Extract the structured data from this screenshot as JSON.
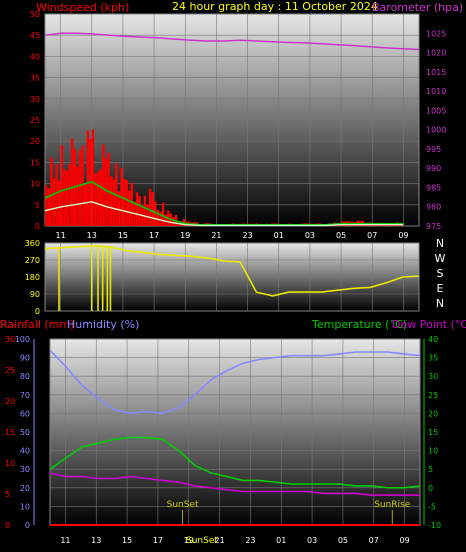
{
  "header": {
    "left_title": "Windspeed (kph)",
    "center_title": "24 hour graph day : 11 October 2024",
    "right_title": "Barometer (hpa)"
  },
  "colors": {
    "wind": "#ff0000",
    "gust": "#00cc00",
    "gust_light": "#ccffcc",
    "baro": "#cc33cc",
    "dir": "#e8e800",
    "humidity": "#8888ff",
    "temperature": "#00cc00",
    "dewpoint": "#cc00cc",
    "rain": "#ff0000",
    "temp_axis": "#00cc00",
    "sun_label": "#cccc00"
  },
  "x_ticks": [
    "11",
    "13",
    "15",
    "17",
    "19",
    "21",
    "23",
    "01",
    "03",
    "05",
    "07",
    "09"
  ],
  "chart_data": [
    {
      "type": "line",
      "panel": "wind-barometer",
      "x": [
        "10",
        "11",
        "12",
        "13",
        "14",
        "15",
        "16",
        "17",
        "18",
        "19",
        "20",
        "21",
        "22",
        "23",
        "00",
        "01",
        "02",
        "03",
        "04",
        "05",
        "06",
        "07",
        "08",
        "09"
      ],
      "series": [
        {
          "name": "Windspeed (kph)",
          "axis": "left",
          "values": [
            12,
            15,
            17,
            19,
            15,
            12,
            9,
            6,
            3,
            1,
            0.5,
            0.5,
            0.5,
            0.5,
            0.5,
            0.5,
            0.5,
            0.5,
            0.5,
            1,
            1,
            1,
            1,
            1
          ]
        },
        {
          "name": "Barometer (hpa)",
          "axis": "right",
          "values": [
            1024.5,
            1025,
            1025,
            1024.8,
            1024.5,
            1024.2,
            1024,
            1023.8,
            1023.5,
            1023.2,
            1023,
            1023,
            1023.2,
            1023,
            1022.8,
            1022.6,
            1022.5,
            1022.3,
            1022,
            1021.8,
            1021.5,
            1021.2,
            1021,
            1020.8
          ]
        }
      ],
      "left_axis": {
        "ticks": [
          "0",
          "5",
          "10",
          "15",
          "20",
          "25",
          "30",
          "35",
          "40",
          "45",
          "50"
        ],
        "range": [
          0,
          50
        ]
      },
      "right_axis": {
        "ticks": [
          "975",
          "980",
          "985",
          "990",
          "995",
          "1000",
          "1005",
          "1010",
          "1015",
          "1020",
          "1025"
        ],
        "range": [
          975,
          1030
        ]
      }
    },
    {
      "type": "line",
      "panel": "wind-direction",
      "x": [
        "10",
        "11",
        "12",
        "13",
        "14",
        "15",
        "16",
        "17",
        "18",
        "19",
        "20",
        "21",
        "22",
        "23",
        "00",
        "01",
        "02",
        "03",
        "04",
        "05",
        "06",
        "07",
        "08",
        "09"
      ],
      "series": [
        {
          "name": "Wind direction",
          "values": [
            330,
            335,
            340,
            345,
            340,
            320,
            310,
            300,
            295,
            290,
            280,
            265,
            260,
            100,
            80,
            100,
            100,
            100,
            110,
            120,
            125,
            150,
            180,
            185
          ]
        }
      ],
      "left_axis": {
        "ticks": [
          "0",
          "90",
          "180",
          "270",
          "360"
        ],
        "range": [
          0,
          360
        ]
      },
      "right_labels": [
        "N",
        "W",
        "S",
        "E",
        "N"
      ]
    },
    {
      "type": "line",
      "panel": "temperature-humidity",
      "x": [
        "10",
        "11",
        "12",
        "13",
        "14",
        "15",
        "16",
        "17",
        "18",
        "19",
        "20",
        "21",
        "22",
        "23",
        "00",
        "01",
        "02",
        "03",
        "04",
        "05",
        "06",
        "07",
        "08",
        "09"
      ],
      "series": [
        {
          "name": "Humidity (%)",
          "axis": "humidity",
          "values": [
            94,
            85,
            75,
            68,
            62,
            60,
            61,
            60,
            63,
            70,
            78,
            83,
            87,
            89,
            90,
            91,
            91,
            91,
            92,
            93,
            93,
            93,
            92,
            91
          ]
        },
        {
          "name": "Temperature (°C)",
          "axis": "right",
          "values": [
            5,
            8,
            11,
            12,
            13,
            13.5,
            13.5,
            13,
            10,
            6,
            4,
            3,
            2,
            2,
            1.5,
            1,
            1,
            1,
            1,
            0.5,
            0.5,
            0,
            0,
            0.5
          ]
        },
        {
          "name": "Dew Point (°C)",
          "axis": "right",
          "values": [
            4,
            3,
            3,
            2.5,
            2.5,
            3,
            2.5,
            2,
            1.5,
            0.5,
            0,
            -0.5,
            -1,
            -1,
            -1,
            -1,
            -1,
            -1.5,
            -1.5,
            -1.5,
            -2,
            -2,
            -2,
            -2
          ]
        },
        {
          "name": "Rainfall (mm)",
          "axis": "rain",
          "values": [
            0,
            0,
            0,
            0,
            0,
            0,
            0,
            0,
            0,
            0,
            0,
            0,
            0,
            0,
            0,
            0,
            0,
            0,
            0,
            0,
            0,
            0,
            0,
            0
          ]
        }
      ],
      "rain_axis": {
        "ticks": [
          "0",
          "5",
          "10",
          "15",
          "20",
          "25",
          "30"
        ],
        "range": [
          0,
          30
        ]
      },
      "humidity_axis": {
        "ticks": [
          "0",
          "10",
          "20",
          "30",
          "40",
          "50",
          "60",
          "70",
          "80",
          "90",
          "100"
        ],
        "range": [
          0,
          100
        ]
      },
      "right_axis": {
        "ticks": [
          "-10",
          "-5",
          "0",
          "5",
          "10",
          "15",
          "20",
          "25",
          "30",
          "35",
          "40"
        ],
        "range": [
          -10,
          40
        ]
      },
      "annotations": [
        {
          "label": "SunSet",
          "x": "18.6"
        },
        {
          "label": "SunRise",
          "x": "08.2"
        }
      ]
    }
  ],
  "bottom": {
    "rain_label": "Rainfall (mm)",
    "humidity_label": "Humidity (%)",
    "temp_label": "Temperature (°C)",
    "dew_label": "Dew Point (°C)",
    "sunset_axis_label": "SunSet"
  }
}
